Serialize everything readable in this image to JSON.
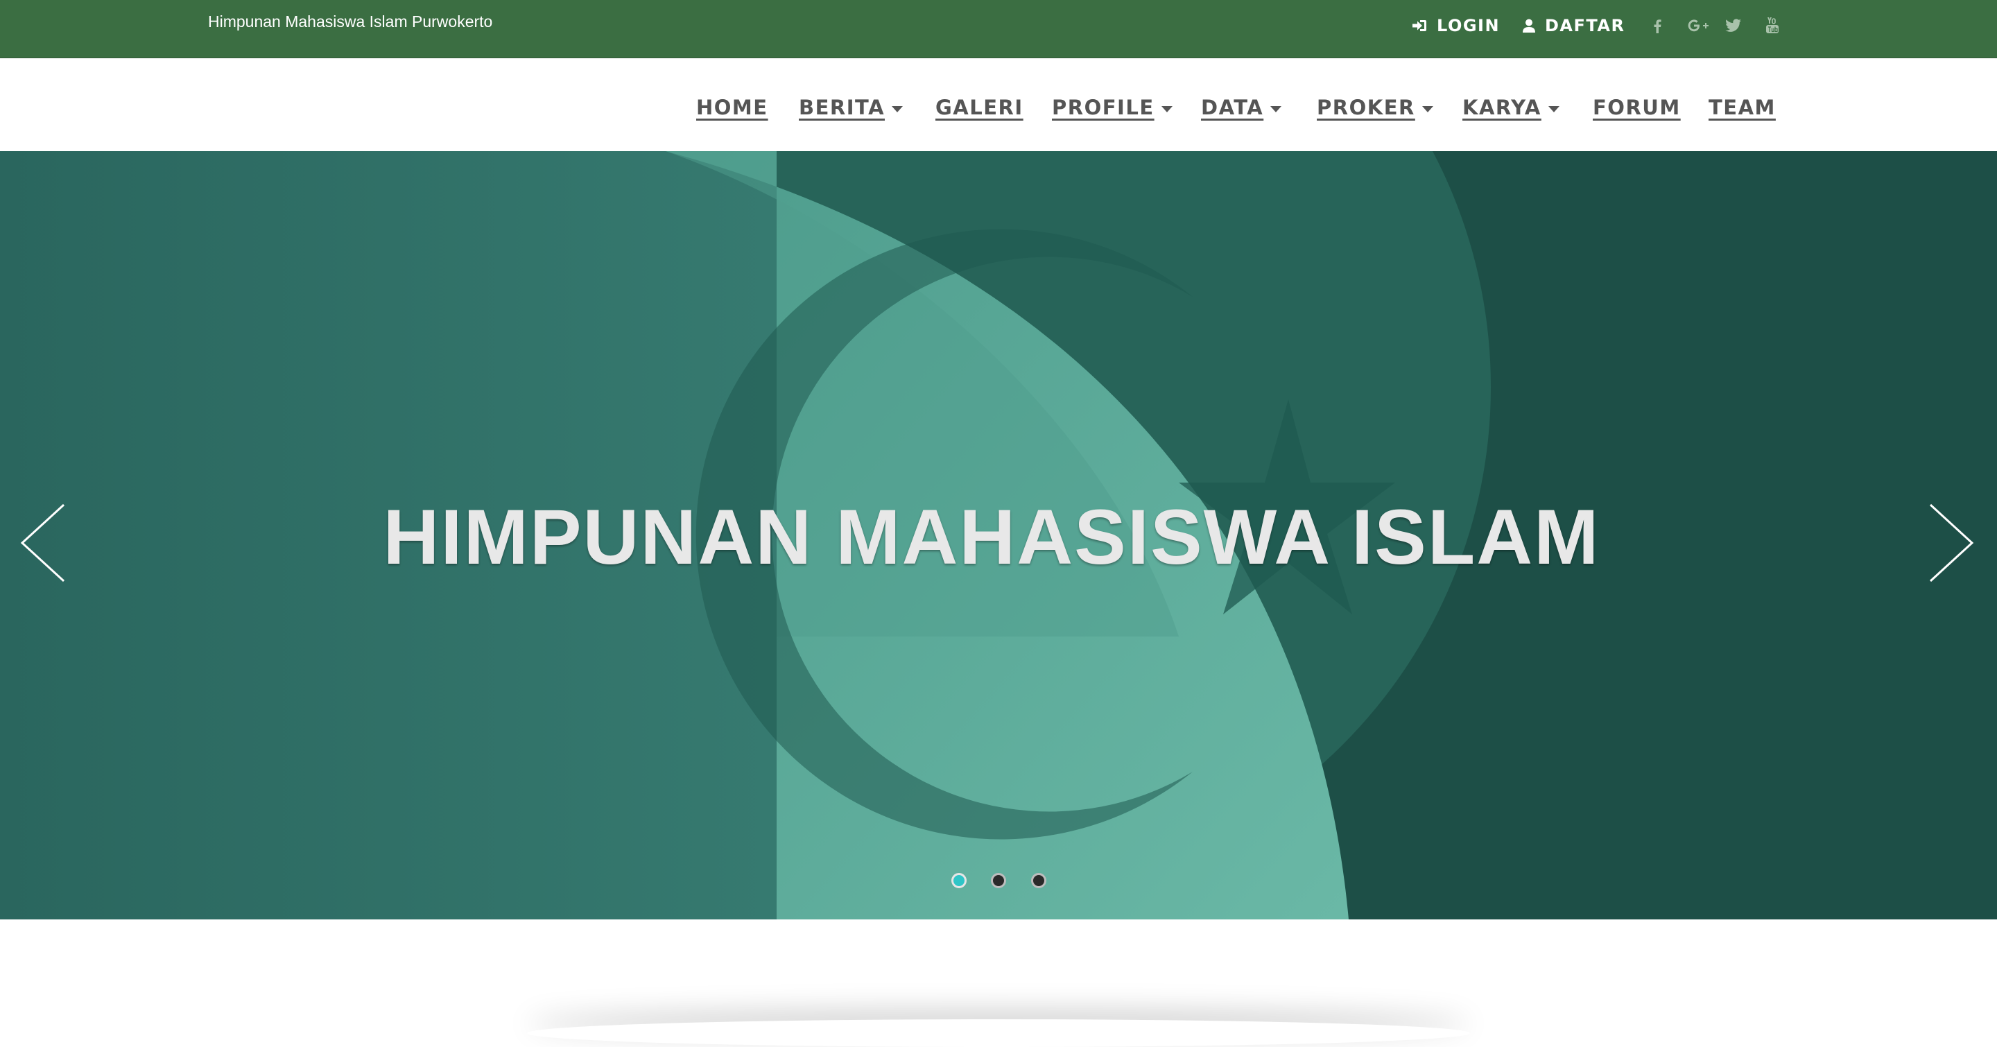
{
  "topbar": {
    "site_title": "Himpunan Mahasiswa Islam Purwokerto",
    "login_label": "LOGIN",
    "daftar_label": "DAFTAR",
    "social_icons": [
      "facebook-icon",
      "google-plus-icon",
      "twitter-icon",
      "youtube-icon"
    ],
    "background_color": "#3b6e42"
  },
  "nav": {
    "items": [
      {
        "label": "HOME",
        "dropdown": false
      },
      {
        "label": "BERITA",
        "dropdown": true
      },
      {
        "label": "GALERI",
        "dropdown": false
      },
      {
        "label": "PROFILE",
        "dropdown": true
      },
      {
        "label": "DATA",
        "dropdown": true
      },
      {
        "label": "PROKER",
        "dropdown": true
      },
      {
        "label": "KARYA",
        "dropdown": true
      },
      {
        "label": "FORUM",
        "dropdown": false
      },
      {
        "label": "TEAM",
        "dropdown": false
      }
    ],
    "text_color": "#555555"
  },
  "hero": {
    "title": "HIMPUNAN MAHASISWA ISLAM",
    "slide_count": 3,
    "active_slide": 1,
    "prev_icon": "chevron-left-icon",
    "next_icon": "chevron-right-icon",
    "colors": {
      "dark": "#1e5048",
      "mid": "#2f6e66",
      "light": "#66b7a3",
      "indicator_active": "#30c5c7"
    }
  }
}
